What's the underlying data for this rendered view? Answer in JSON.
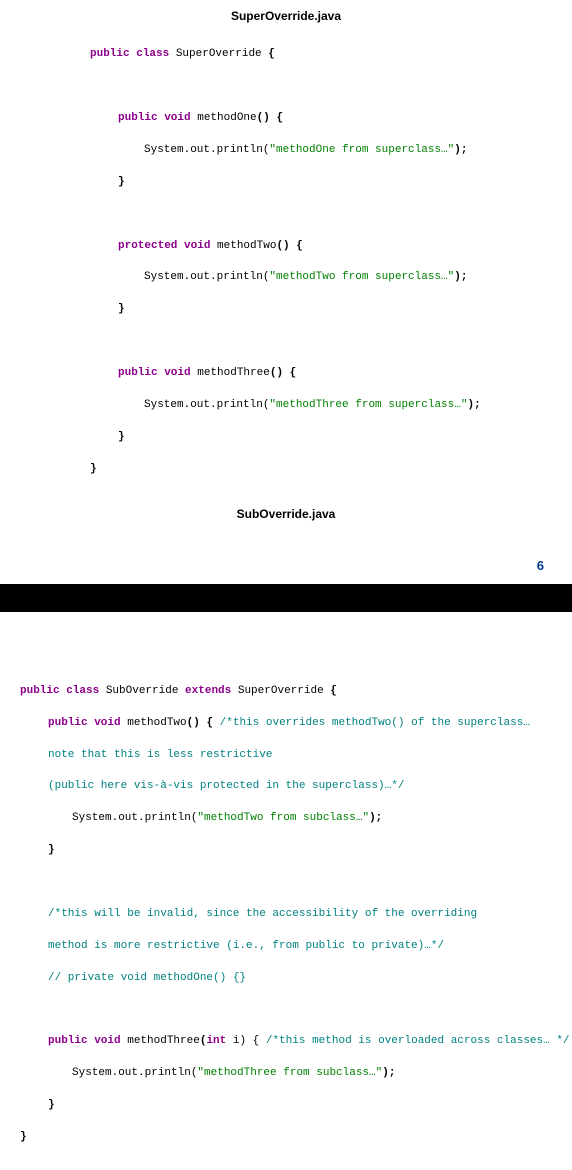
{
  "file1_heading": "SuperOverride.java",
  "file2_heading": "SubOverride.java",
  "page_number": "6",
  "super": {
    "l0": "public ",
    "l0b": "class ",
    "l0c": "SuperOverride ",
    "l0d": "{",
    "m1_sig_a": "public void ",
    "m1_sig_b": "methodOne",
    "m1_sig_c": "() {",
    "m1_body_a": "System.out.println(",
    "m1_body_b": "\"methodOne from superclass…\"",
    "m1_body_c": ");",
    "m1_close": "}",
    "m2_sig_a": "protected void ",
    "m2_sig_b": "methodTwo",
    "m2_sig_c": "() {",
    "m2_body_a": "System.out.println(",
    "m2_body_b": "\"methodTwo from superclass…\"",
    "m2_body_c": ");",
    "m2_close": "}",
    "m3_sig_a": "public void ",
    "m3_sig_b": "methodThree",
    "m3_sig_c": "() {",
    "m3_body_a": "System.out.println(",
    "m3_body_b": "\"methodThree from superclass…\"",
    "m3_body_c": ");",
    "m3_close": "}",
    "close": "}"
  },
  "sub": {
    "l0a": "public class ",
    "l0b": "SubOverride ",
    "l0c": "extends ",
    "l0d": "SuperOverride ",
    "l0e": "{",
    "m2_sig_a": "public void ",
    "m2_sig_b": "methodTwo",
    "m2_sig_c": "() { ",
    "m2_cmt1": "/*this overrides methodTwo() of the superclass…",
    "m2_cmt2": "note that this is less restrictive",
    "m2_cmt3": "(public here vis-à-vis protected in the superclass)…*/",
    "m2_body_a": "System.out.println(",
    "m2_body_b": "\"methodTwo from subclass…\"",
    "m2_body_c": ");",
    "m2_close": "}",
    "cmt_block1": "/*this will be invalid, since the accessibility of the overriding",
    "cmt_block2": "method is more restrictive (i.e., from public to private)…*/",
    "cmt_block3": "// private void methodOne() {}",
    "m3_sig_a": "public void ",
    "m3_sig_b": "methodThree",
    "m3_sig_c": "(",
    "m3_sig_d": "int",
    "m3_sig_e": " i) { ",
    "m3_cmt": "/*this method is overloaded across classes… */",
    "m3_body_a": "System.out.println(",
    "m3_body_b": "\"methodThree from subclass…\"",
    "m3_body_c": ");",
    "m3_close": "}",
    "close": "}"
  }
}
